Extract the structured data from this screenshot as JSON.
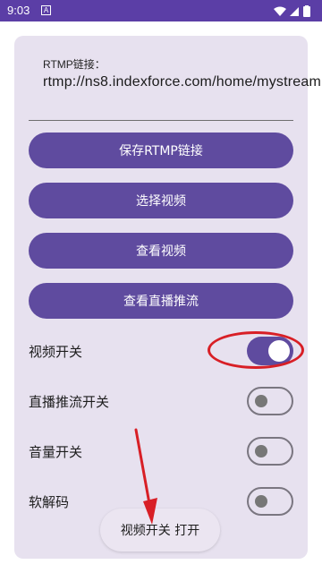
{
  "status_bar": {
    "time": "9:03",
    "notification_icon": "A"
  },
  "rtmp": {
    "label": "RTMP链接：",
    "url": "rtmp://ns8.indexforce.com/home/mystream"
  },
  "buttons": {
    "save": "保存RTMP链接",
    "select_video": "选择视频",
    "view_video": "查看视频",
    "view_stream": "查看直播推流"
  },
  "toggles": [
    {
      "label": "视频开关",
      "on": true
    },
    {
      "label": "直播推流开关",
      "on": false
    },
    {
      "label": "音量开关",
      "on": false
    },
    {
      "label": "软解码",
      "on": false
    }
  ],
  "toast": "视频开关 打开",
  "colors": {
    "accent": "#5f4b9f",
    "status_bar": "#5b3ea6",
    "highlight": "#d81f26"
  }
}
